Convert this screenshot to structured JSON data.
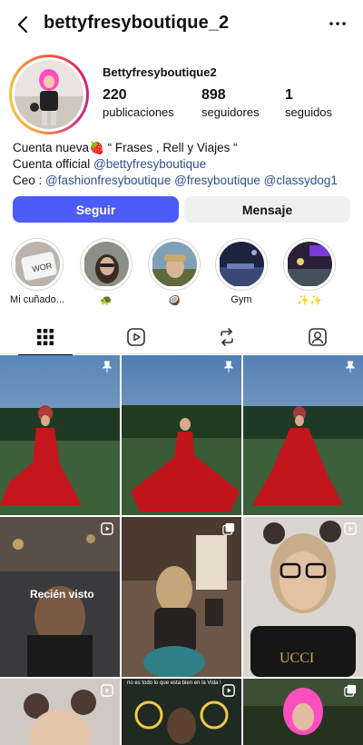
{
  "header": {
    "username": "bettyfresyboutique_2"
  },
  "profile": {
    "display_name": "Bettyfresyboutique2",
    "stats": [
      {
        "value": "220",
        "label": "publicaciones"
      },
      {
        "value": "898",
        "label": "seguidores"
      },
      {
        "value": "1",
        "label": "seguidos"
      }
    ],
    "bio_line1": "Cuenta nueva🍓 “ Frases  , Rell y Viajes “",
    "bio_line2_prefix": "Cuenta official ",
    "bio_line2_link": "@bettyfresyboutique",
    "bio_line3_prefix": "Ceo : ",
    "bio_line3_link1": "@fashionfresyboutique",
    "bio_line3_link2": "@fresyboutique",
    "bio_line3_link3": "@classydog1"
  },
  "buttons": {
    "follow": "Seguir",
    "message": "Mensaje"
  },
  "highlights": [
    {
      "label": "Mi cuñado..."
    },
    {
      "label": "🐢"
    },
    {
      "label": "🥥"
    },
    {
      "label": "Gym"
    },
    {
      "label": "✨✨"
    }
  ],
  "grid": {
    "overlay_recien": "Recién visto",
    "overlay_small": "no es todo lo que esta bien en la Vida !"
  },
  "colors": {
    "accent": "#4d5bf8",
    "link": "#2f4e8f"
  }
}
